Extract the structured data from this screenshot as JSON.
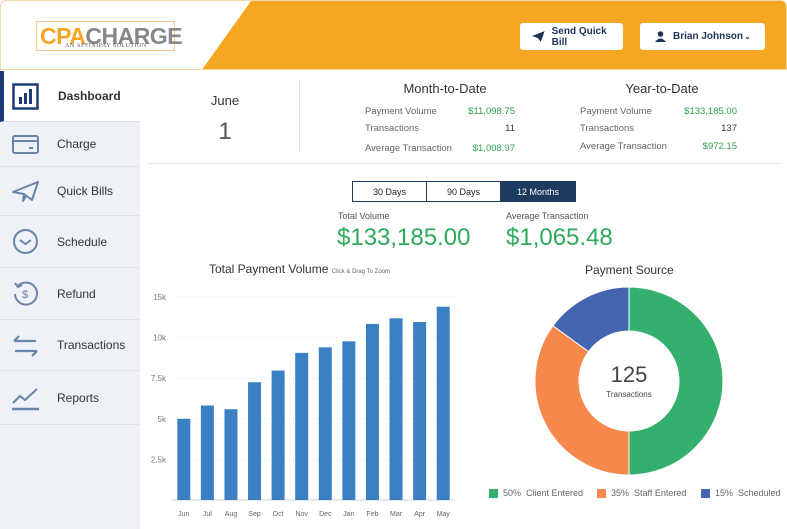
{
  "header": {
    "logo_text": "CPACHARGE",
    "logo_cpa": "CPA",
    "logo_charge": "CHARGE",
    "logo_tagline": "AN AFFINIPAY SOLUTION",
    "send_quick_bill": "Send Quick Bill",
    "user_name": "Brian Johnson",
    "accent": "#f5a623"
  },
  "sidebar": {
    "items": [
      {
        "label": "Dashboard",
        "icon": "bar-chart-icon"
      },
      {
        "label": "Charge",
        "icon": "credit-card-icon"
      },
      {
        "label": "Quick Bills",
        "icon": "paper-plane-icon"
      },
      {
        "label": "Schedule",
        "icon": "clock-icon"
      },
      {
        "label": "Refund",
        "icon": "refund-icon"
      },
      {
        "label": "Transactions",
        "icon": "arrows-exchange-icon"
      },
      {
        "label": "Reports",
        "icon": "line-chart-icon"
      }
    ]
  },
  "date": {
    "month": "June",
    "day": "1"
  },
  "mtd": {
    "title": "Month-to-Date",
    "rows": [
      {
        "label": "Payment Volume",
        "value": "$11,098.75"
      },
      {
        "label": "Transactions",
        "value": "11"
      },
      {
        "label": "Average Transaction",
        "value": "$1,008.97"
      }
    ]
  },
  "ytd": {
    "title": "Year-to-Date",
    "rows": [
      {
        "label": "Payment Volume",
        "value": "$133,185.00"
      },
      {
        "label": "Transactions",
        "value": "137"
      },
      {
        "label": "Average Transaction",
        "value": "$972.15"
      }
    ]
  },
  "range": {
    "options": [
      "30 Days",
      "90 Days",
      "12 Months"
    ],
    "selected": "12 Months"
  },
  "kpis": {
    "total_label": "Total Volume",
    "total_value": "$133,185.00",
    "avg_label": "Average Transaction",
    "avg_value": "$1,065.48"
  },
  "chart_data": [
    {
      "type": "bar",
      "title": "Total Payment Volume",
      "subtitle": "Click & Drag To Zoom",
      "categories": [
        "Jun",
        "Jul",
        "Aug",
        "Sep",
        "Oct",
        "Nov",
        "Dec",
        "Jan",
        "Feb",
        "Mar",
        "Apr",
        "May"
      ],
      "values": [
        5000,
        5820,
        5590,
        7250,
        7970,
        9060,
        9400,
        9770,
        10840,
        11190,
        10960,
        11900
      ],
      "yticks": [
        2500,
        5000,
        7500,
        10000,
        12500
      ],
      "ytick_labels": [
        "2.5k",
        "5k",
        "7.5k",
        "10k",
        "15k"
      ],
      "ylim": [
        0,
        12500
      ],
      "grid": true,
      "color": "#3a80c3"
    },
    {
      "type": "pie",
      "title": "Payment Source",
      "center_value": "125",
      "center_label": "Transactions",
      "slices": [
        {
          "label": "Client Entered",
          "percent": 50,
          "percent_label": "50%",
          "color": "#33b06e"
        },
        {
          "label": "Staff Entered",
          "percent": 35,
          "percent_label": "35%",
          "color": "#f5884a"
        },
        {
          "label": "Scheduled",
          "percent": 15,
          "percent_label": "15%",
          "color": "#4466b0"
        }
      ],
      "legend": "bottom"
    }
  ]
}
